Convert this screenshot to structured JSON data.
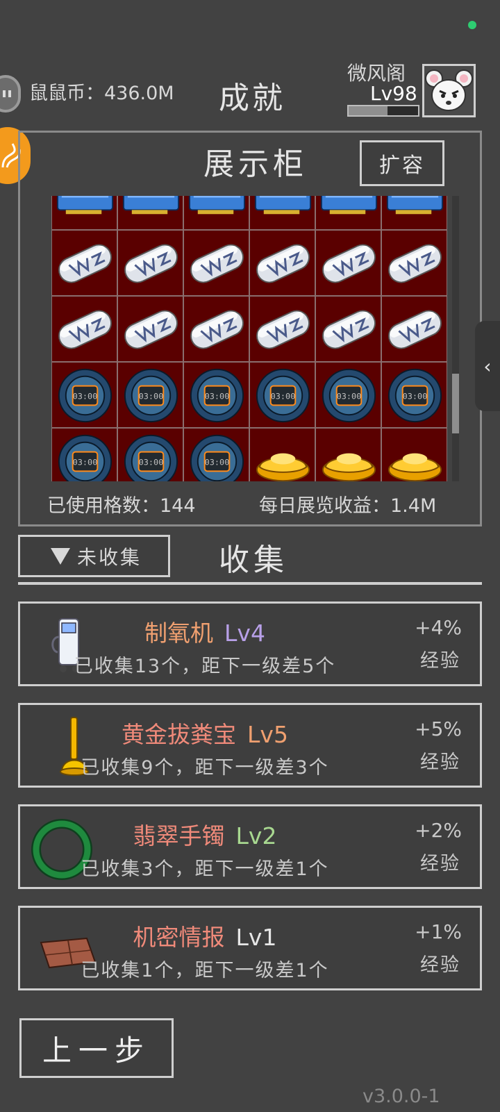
{
  "header": {
    "coin_label": "鼠鼠币：436.0M",
    "title": "成就",
    "player_name": "微风阁",
    "player_level": "Lv98",
    "level_progress": 0.56
  },
  "showcase": {
    "title": "展示柜",
    "expand_label": "扩容",
    "used_slots": "已使用格数：144",
    "daily_income": "每日展览收益：1.4M",
    "rows": [
      [
        "gpu",
        "gpu",
        "gpu",
        "gpu",
        "gpu",
        "gpu"
      ],
      [
        "capsule",
        "capsule",
        "capsule",
        "capsule",
        "capsule",
        "capsule"
      ],
      [
        "capsule",
        "capsule",
        "capsule",
        "capsule",
        "capsule",
        "capsule"
      ],
      [
        "watch",
        "watch",
        "watch",
        "watch",
        "watch",
        "watch"
      ],
      [
        "watch",
        "watch",
        "watch",
        "gold-ingot",
        "gold-ingot",
        "gold-ingot"
      ]
    ],
    "scroll_position": 0.62
  },
  "collection": {
    "filter_label": "未收集",
    "title": "收集",
    "items": [
      {
        "icon": "oxygen-machine-icon",
        "name": "制氧机",
        "level": "Lv4",
        "progress": "已收集13个，距下一级差5个",
        "bonus": "+4%",
        "bonus_unit": "经验",
        "name_color": "#f0a070",
        "level_color": "#b8a0e8"
      },
      {
        "icon": "golden-plunger-icon",
        "name": "黄金拔粪宝",
        "level": "Lv5",
        "progress": "已收集9个，距下一级差3个",
        "bonus": "+5%",
        "bonus_unit": "经验",
        "name_color": "#f08a7a",
        "level_color": "#f0a070"
      },
      {
        "icon": "jade-bracelet-icon",
        "name": "翡翠手镯",
        "level": "Lv2",
        "progress": "已收集3个，距下一级差1个",
        "bonus": "+2%",
        "bonus_unit": "经验",
        "name_color": "#f08a7a",
        "level_color": "#a8d890"
      },
      {
        "icon": "secret-intel-icon",
        "name": "机密情报",
        "level": "Lv1",
        "progress": "已收集1个，距下一级差1个",
        "bonus": "+1%",
        "bonus_unit": "经验",
        "name_color": "#f08a7a",
        "level_color": "#e6e6e6"
      }
    ]
  },
  "footer": {
    "back_label": "上一步",
    "version": "v3.0.0-1"
  }
}
